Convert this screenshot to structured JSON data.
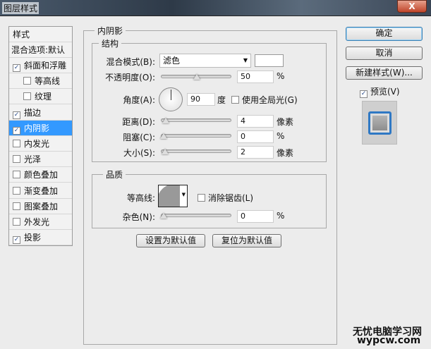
{
  "window": {
    "title": "图层样式",
    "close": "X"
  },
  "sidebar": {
    "header": "样式",
    "blend": "混合选项:默认",
    "items": [
      {
        "label": "斜面和浮雕",
        "checked": true
      },
      {
        "label": "等高线",
        "checked": false,
        "indent": true
      },
      {
        "label": "纹理",
        "checked": false,
        "indent": true
      },
      {
        "label": "描边",
        "checked": true
      },
      {
        "label": "内阴影",
        "checked": true,
        "selected": true
      },
      {
        "label": "内发光",
        "checked": false
      },
      {
        "label": "光泽",
        "checked": false
      },
      {
        "label": "颜色叠加",
        "checked": false
      },
      {
        "label": "渐变叠加",
        "checked": false
      },
      {
        "label": "图案叠加",
        "checked": false
      },
      {
        "label": "外发光",
        "checked": false
      },
      {
        "label": "投影",
        "checked": true
      }
    ]
  },
  "panel": {
    "title": "内阴影",
    "structure": "结构",
    "quality": "品质",
    "blend_label": "混合模式(B):",
    "blend_value": "滤色",
    "blend_color": "#ffffff",
    "opacity_label": "不透明度(O):",
    "opacity": "50",
    "opacity_unit": "%",
    "angle_label": "角度(A):",
    "angle": "90",
    "angle_unit": "度",
    "global_light": "使用全局光(G)",
    "distance_label": "距离(D):",
    "distance": "4",
    "distance_unit": "像素",
    "choke_label": "阻塞(C):",
    "choke": "0",
    "choke_unit": "%",
    "size_label": "大小(S):",
    "size": "2",
    "size_unit": "像素",
    "contour_label": "等高线:",
    "antialias": "消除锯齿(L)",
    "noise_label": "杂色(N):",
    "noise": "0",
    "noise_unit": "%",
    "make_default": "设置为默认值",
    "reset_default": "复位为默认值"
  },
  "buttons": {
    "ok": "确定",
    "cancel": "取消",
    "new_style": "新建样式(W)...",
    "preview": "预览(V)"
  },
  "watermark": {
    "line1": "无忧电脑学习网",
    "line2": "wypcw.com"
  }
}
